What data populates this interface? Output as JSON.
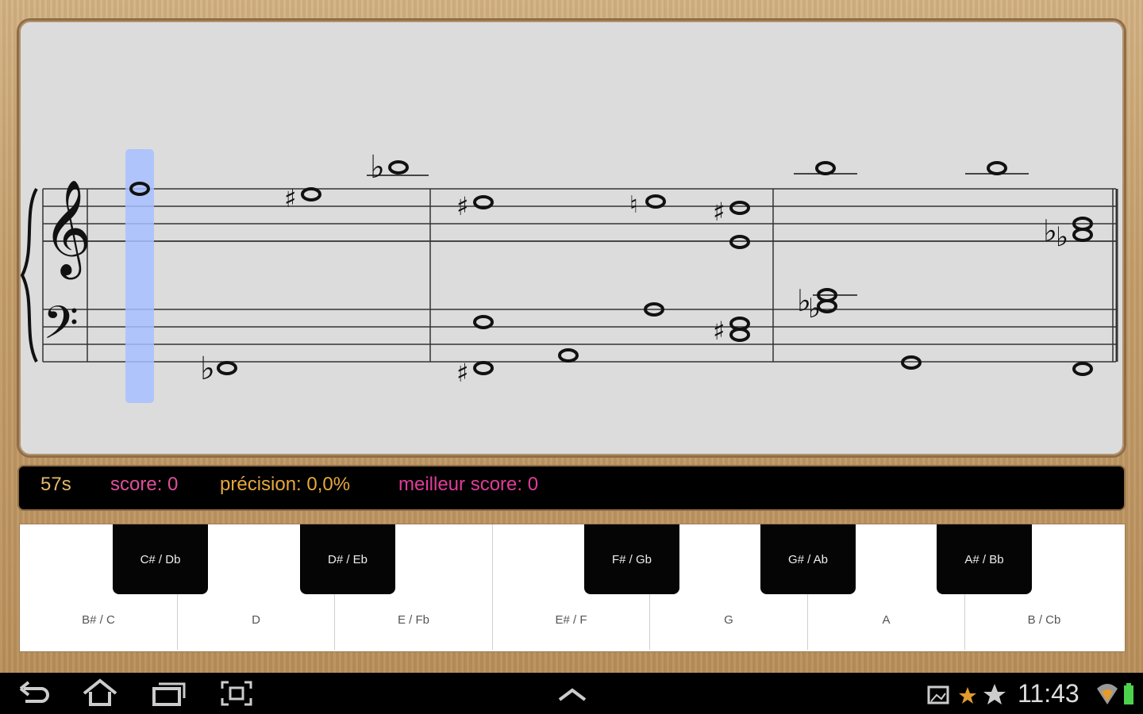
{
  "status": {
    "timer": "57s",
    "score": "score: 0",
    "precision": "précision: 0,0%",
    "best": "meilleur score: 0",
    "colors": {
      "timer": "#e3b96b",
      "score": "#e04f9d",
      "precision": "#e6a83c",
      "best": "#e03c9a"
    }
  },
  "keyboard": {
    "white_keys": [
      "B# / C",
      "D",
      "E / Fb",
      "E# / F",
      "G",
      "A",
      "B / Cb"
    ],
    "black_keys": [
      "C# / Db",
      "D# / Eb",
      "F# / Gb",
      "G# / Ab",
      "A# / Bb"
    ]
  },
  "score_notation": {
    "clefs": [
      "treble",
      "bass"
    ],
    "measures": 3,
    "highlighted_note": "first"
  },
  "system_bar": {
    "clock": "11:43",
    "icons": [
      "back-icon",
      "home-icon",
      "recent-apps-icon",
      "screenshot-icon",
      "up-chevron-icon",
      "gallery-icon",
      "star-icon",
      "star-icon",
      "wifi-icon",
      "battery-icon"
    ]
  }
}
